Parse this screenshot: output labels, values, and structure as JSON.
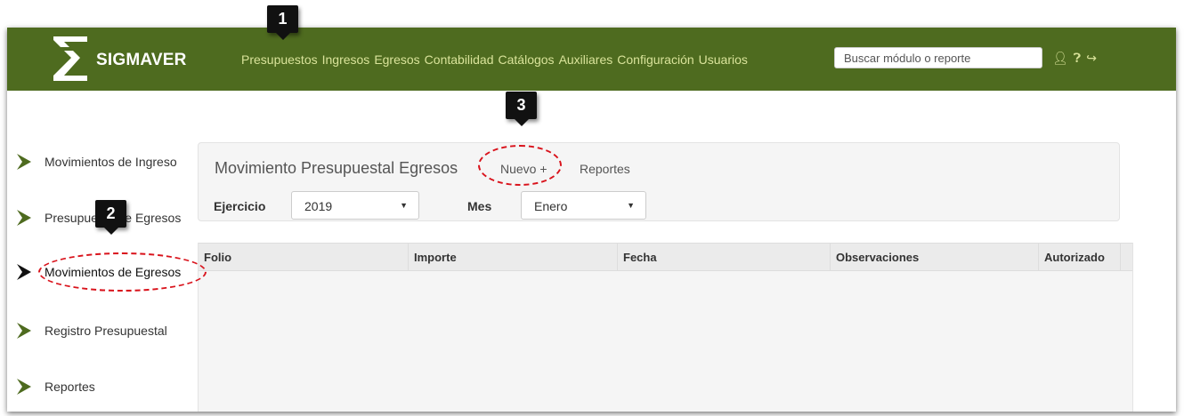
{
  "navbar": {
    "brand": "SIGMAVER",
    "menu": [
      "Presupuestos",
      "Ingresos",
      "Egresos",
      "Contabilidad",
      "Catálogos",
      "Auxiliares",
      "Configuración",
      "Usuarios"
    ],
    "search_placeholder": "Buscar módulo o reporte",
    "icons": [
      "user-icon",
      "help-icon",
      "logout-icon"
    ],
    "color": "#4e6b1f"
  },
  "sidebar": {
    "items": [
      {
        "label": "Movimientos de Ingreso"
      },
      {
        "label": "Presupuesto de Egresos"
      },
      {
        "label": "Movimientos de Egresos",
        "active": true
      },
      {
        "label": "Registro Presupuestal"
      },
      {
        "label": "Reportes"
      }
    ]
  },
  "panel": {
    "title": "Movimiento Presupuestal Egresos",
    "new_label": "Nuevo +",
    "reports_label": "Reportes",
    "ejercicio_label": "Ejercicio",
    "ejercicio_value": "2019",
    "mes_label": "Mes",
    "mes_value": "Enero"
  },
  "table": {
    "columns": [
      "Folio",
      "Importe",
      "Fecha",
      "Observaciones",
      "Autorizado"
    ]
  },
  "annotations": {
    "callouts": [
      "1",
      "2",
      "3"
    ],
    "color": "#d9121b"
  }
}
